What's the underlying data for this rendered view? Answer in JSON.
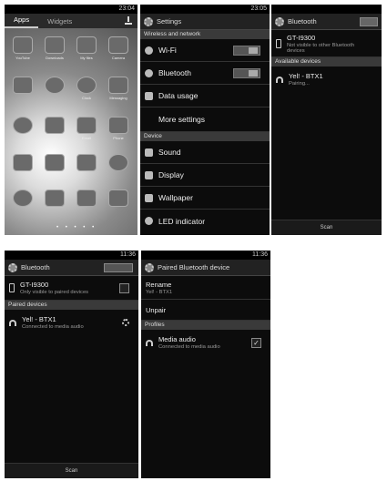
{
  "screen1": {
    "status_time": "23:04",
    "tabs": [
      "Apps",
      "Widgets"
    ],
    "apps": [
      "YouTube",
      "Downloads",
      "My files",
      "Camera",
      "",
      "",
      "Clock",
      "Messaging",
      "",
      "",
      "Email",
      "Phone",
      "",
      "",
      "",
      "",
      "",
      "",
      "",
      ""
    ]
  },
  "screen2": {
    "status_time": "23:05",
    "title": "Settings",
    "section_wireless": "Wireless and network",
    "wifi": "Wi-Fi",
    "bluetooth": "Bluetooth",
    "data_usage": "Data usage",
    "more_settings": "More settings",
    "section_device": "Device",
    "sound": "Sound",
    "display": "Display",
    "wallpaper": "Wallpaper",
    "led": "LED indicator"
  },
  "screen3": {
    "title": "Bluetooth",
    "device_name": "GT-I9300",
    "device_sub": "Not visible to other Bluetooth devices",
    "section_available": "Available devices",
    "available_name": "Yel! - BTX1",
    "available_sub": "Pairing...",
    "scan": "Scan"
  },
  "screen4": {
    "status_time": "11:36",
    "title": "Bluetooth",
    "device_name": "GT-I9300",
    "device_sub": "Only visible to paired devices",
    "section_paired": "Paired devices",
    "paired_name": "Yel! - BTX1",
    "paired_sub": "Connected to media audio",
    "scan": "Scan"
  },
  "screen5": {
    "status_time": "11:36",
    "title": "Paired Bluetooth device",
    "rename": "Rename",
    "rename_value": "Yel! - BTX1",
    "unpair": "Unpair",
    "section_profiles": "Profiles",
    "media_audio": "Media audio",
    "media_sub": "Connected to media audio"
  }
}
